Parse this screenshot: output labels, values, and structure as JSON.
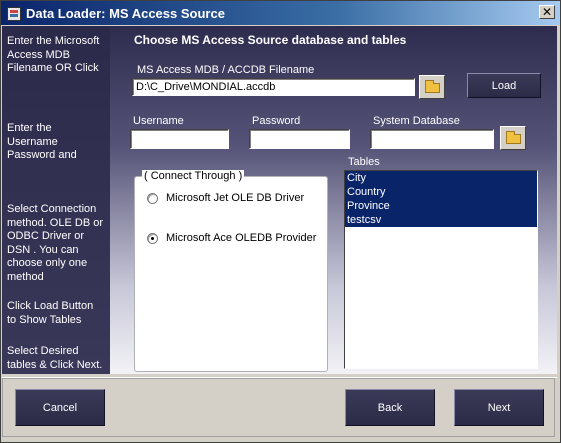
{
  "window": {
    "title": "Data Loader: MS Access Source",
    "close_glyph": "✕"
  },
  "sidebar": {
    "step1": "Enter the Microsoft Access MDB Filename OR Click",
    "step2": "Enter the Username Password and",
    "step3": "Select Connection method. OLE DB or ODBC Driver or DSN . You can choose only one method",
    "step4": "Click Load Button to Show Tables",
    "step5": "Select Desired tables & Click Next."
  },
  "main": {
    "header": "Choose MS Access Source database and tables",
    "filename_label": "MS Access MDB / ACCDB Filename",
    "filename_value": "D:\\C_Drive\\MONDIAL.accdb",
    "load_label": "Load",
    "username_label": "Username",
    "password_label": "Password",
    "system_db_label": "System Database",
    "username_value": "",
    "password_value": "",
    "system_db_value": ""
  },
  "connect": {
    "group_title": "( Connect Through )",
    "options": [
      {
        "label": "Microsoft Jet OLE DB Driver",
        "checked": false
      },
      {
        "label": "Microsoft Ace OLEDB Provider",
        "checked": true
      }
    ]
  },
  "tables": {
    "label": "Tables",
    "items": [
      "City",
      "Country",
      "Province",
      "testcsv"
    ],
    "selection_color": "#0a246a"
  },
  "footer": {
    "cancel_label": "Cancel",
    "back_label": "Back",
    "next_label": "Next"
  },
  "icons": {
    "folder": "folder-icon",
    "close": "close-icon",
    "app": "app-icon"
  }
}
